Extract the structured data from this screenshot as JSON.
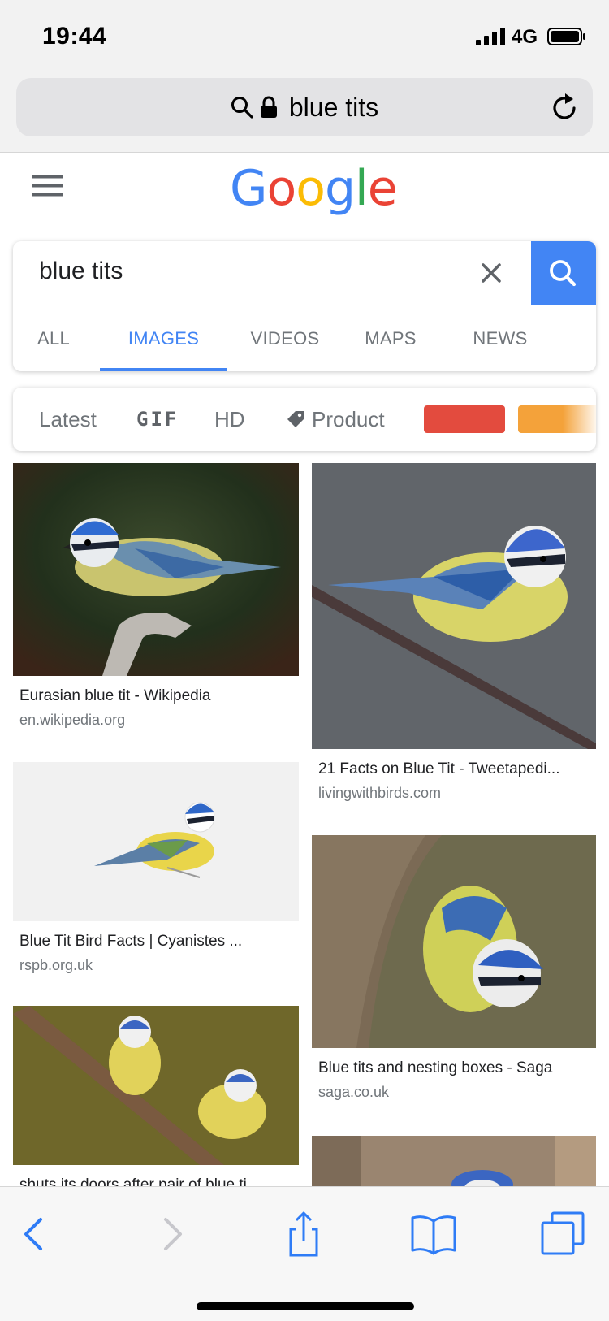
{
  "status_bar": {
    "time": "19:44",
    "network": "4G",
    "icons": [
      "signal-bars-icon",
      "battery-icon"
    ]
  },
  "browser": {
    "address_text": "blue tits",
    "icons": [
      "search-icon",
      "lock-icon",
      "reload-icon"
    ]
  },
  "google": {
    "logo_letters": [
      {
        "char": "G",
        "color": "#4285F4"
      },
      {
        "char": "o",
        "color": "#EA4335"
      },
      {
        "char": "o",
        "color": "#FBBC05"
      },
      {
        "char": "g",
        "color": "#4285F4"
      },
      {
        "char": "l",
        "color": "#34A853"
      },
      {
        "char": "e",
        "color": "#EA4335"
      }
    ],
    "search_value": "blue tits",
    "tabs": [
      {
        "label": "ALL",
        "active": false
      },
      {
        "label": "IMAGES",
        "active": true
      },
      {
        "label": "VIDEOS",
        "active": false
      },
      {
        "label": "MAPS",
        "active": false
      },
      {
        "label": "NEWS",
        "active": false
      }
    ],
    "filters": {
      "latest": "Latest",
      "gif": "GIF",
      "hd": "HD",
      "product": "Product",
      "color_swatches": [
        "#E34B3E",
        "#F4A23A"
      ]
    },
    "accent_color": "#4285F4"
  },
  "results": [
    {
      "title": "Eurasian blue tit - Wikipedia",
      "source": "en.wikipedia.org"
    },
    {
      "title": "21 Facts on Blue Tit - Tweetapedi...",
      "source": "livingwithbirds.com"
    },
    {
      "title": "Blue Tit Bird Facts | Cyanistes ...",
      "source": "rspb.org.uk"
    },
    {
      "title": "Blue tits and nesting boxes - Saga",
      "source": "saga.co.uk"
    },
    {
      "title": "shuts its doors after pair of blue ti...",
      "source": ""
    }
  ],
  "toolbar": {
    "icons": [
      "back-icon",
      "forward-icon",
      "share-icon",
      "bookmarks-icon",
      "tabs-icon"
    ]
  }
}
